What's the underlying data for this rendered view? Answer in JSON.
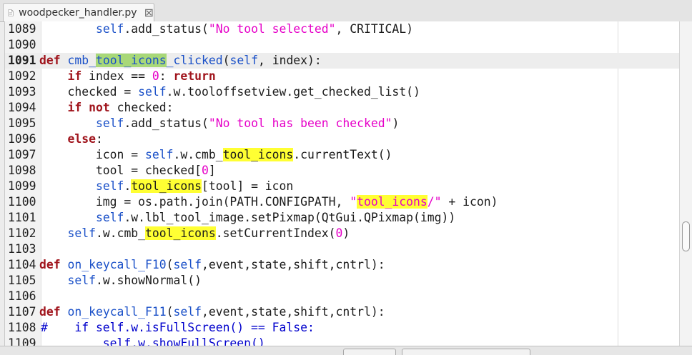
{
  "tab": {
    "icon": "file-icon",
    "label": "woodpecker_handler.py",
    "close": "⊠"
  },
  "editor": {
    "current_line": "1091",
    "lines": [
      {
        "ln": "1089",
        "segs": [
          {
            "t": "        "
          },
          {
            "t": "self",
            "c": "self"
          },
          {
            "t": ".add_status("
          },
          {
            "t": "\"No tool selected\"",
            "c": "str"
          },
          {
            "t": ", CRITICAL)"
          }
        ]
      },
      {
        "ln": "1090",
        "segs": []
      },
      {
        "ln": "1091",
        "segs": [
          {
            "t": "def",
            "c": "kw"
          },
          {
            "t": " "
          },
          {
            "t": "cmb_",
            "c": "fn"
          },
          {
            "t": "tool_icons",
            "c": "fn hlg"
          },
          {
            "t": "_clicked",
            "c": "fn"
          },
          {
            "t": "("
          },
          {
            "t": "self",
            "c": "self"
          },
          {
            "t": ", index):"
          }
        ]
      },
      {
        "ln": "1092",
        "segs": [
          {
            "t": "    "
          },
          {
            "t": "if",
            "c": "kw"
          },
          {
            "t": " index == "
          },
          {
            "t": "0",
            "c": "num"
          },
          {
            "t": ": "
          },
          {
            "t": "return",
            "c": "kw"
          }
        ]
      },
      {
        "ln": "1093",
        "segs": [
          {
            "t": "    checked = "
          },
          {
            "t": "self",
            "c": "self"
          },
          {
            "t": ".w.tooloffsetview.get_checked_list()"
          }
        ]
      },
      {
        "ln": "1094",
        "segs": [
          {
            "t": "    "
          },
          {
            "t": "if",
            "c": "kw"
          },
          {
            "t": " "
          },
          {
            "t": "not",
            "c": "kw"
          },
          {
            "t": " checked:"
          }
        ]
      },
      {
        "ln": "1095",
        "segs": [
          {
            "t": "        "
          },
          {
            "t": "self",
            "c": "self"
          },
          {
            "t": ".add_status("
          },
          {
            "t": "\"No tool has been checked\"",
            "c": "str"
          },
          {
            "t": ")"
          }
        ]
      },
      {
        "ln": "1096",
        "segs": [
          {
            "t": "    "
          },
          {
            "t": "else",
            "c": "kw"
          },
          {
            "t": ":"
          }
        ]
      },
      {
        "ln": "1097",
        "segs": [
          {
            "t": "        icon = "
          },
          {
            "t": "self",
            "c": "self"
          },
          {
            "t": ".w.cmb_"
          },
          {
            "t": "tool_icons",
            "c": "hl"
          },
          {
            "t": ".currentText()"
          }
        ]
      },
      {
        "ln": "1098",
        "segs": [
          {
            "t": "        tool = checked["
          },
          {
            "t": "0",
            "c": "num"
          },
          {
            "t": "]"
          }
        ]
      },
      {
        "ln": "1099",
        "segs": [
          {
            "t": "        "
          },
          {
            "t": "self",
            "c": "self"
          },
          {
            "t": "."
          },
          {
            "t": "tool_icons",
            "c": "hl"
          },
          {
            "t": "[tool] = icon"
          }
        ]
      },
      {
        "ln": "1100",
        "segs": [
          {
            "t": "        img = os.path.join(PATH.CONFIGPATH, "
          },
          {
            "t": "\"",
            "c": "str"
          },
          {
            "t": "tool_icons",
            "c": "str hl"
          },
          {
            "t": "/\"",
            "c": "str"
          },
          {
            "t": " + icon)"
          }
        ]
      },
      {
        "ln": "1101",
        "segs": [
          {
            "t": "        "
          },
          {
            "t": "self",
            "c": "self"
          },
          {
            "t": ".w.lbl_tool_image.setPixmap(QtGui.QPixmap(img))"
          }
        ]
      },
      {
        "ln": "1102",
        "segs": [
          {
            "t": "    "
          },
          {
            "t": "self",
            "c": "self"
          },
          {
            "t": ".w.cmb_"
          },
          {
            "t": "tool_icons",
            "c": "hl"
          },
          {
            "t": ".setCurrentIndex("
          },
          {
            "t": "0",
            "c": "num"
          },
          {
            "t": ")"
          }
        ]
      },
      {
        "ln": "1103",
        "segs": []
      },
      {
        "ln": "1104",
        "segs": [
          {
            "t": "def",
            "c": "kw"
          },
          {
            "t": " "
          },
          {
            "t": "on_keycall_F10",
            "c": "fn"
          },
          {
            "t": "("
          },
          {
            "t": "self",
            "c": "self"
          },
          {
            "t": ",event,state,shift,cntrl):"
          }
        ]
      },
      {
        "ln": "1105",
        "segs": [
          {
            "t": "    "
          },
          {
            "t": "self",
            "c": "self"
          },
          {
            "t": ".w.showNormal()"
          }
        ]
      },
      {
        "ln": "1106",
        "segs": []
      },
      {
        "ln": "1107",
        "segs": [
          {
            "t": "def",
            "c": "kw"
          },
          {
            "t": " "
          },
          {
            "t": "on_keycall_F11",
            "c": "fn"
          },
          {
            "t": "("
          },
          {
            "t": "self",
            "c": "self"
          },
          {
            "t": ",event,state,shift,cntrl):"
          }
        ]
      },
      {
        "ln": "1108",
        "marker": "#",
        "segs": [
          {
            "t": "     if self.w.isFullScreen() == False:",
            "c": "cmt"
          }
        ]
      },
      {
        "ln": "1109",
        "segs": [
          {
            "t": "         self.w.showFullScreen()",
            "c": "cmt"
          }
        ]
      }
    ]
  },
  "scrollbar": {
    "position_fraction": 0.66
  }
}
